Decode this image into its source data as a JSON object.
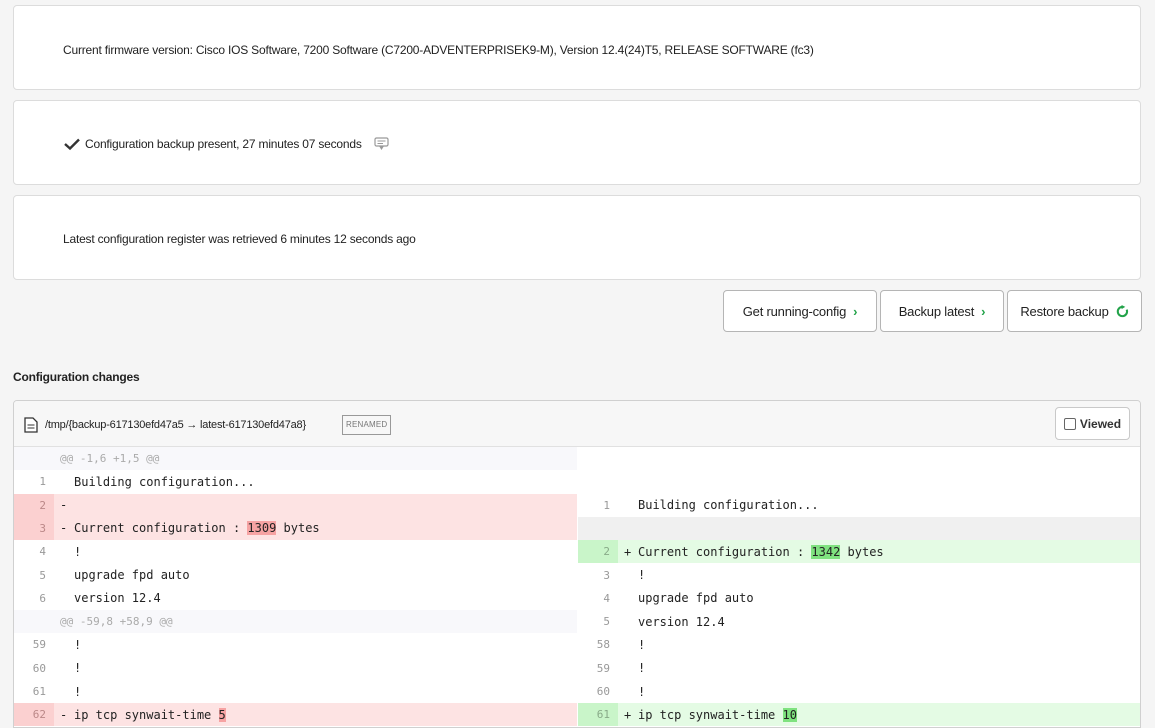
{
  "cards": {
    "firmware": "Current firmware version: Cisco IOS Software, 7200 Software (C7200-ADVENTERPRISEK9-M), Version 12.4(24)T5, RELEASE SOFTWARE (fc3)",
    "backup_status": "Configuration backup present, 27 minutes 07 seconds",
    "register": "Latest configuration register was retrieved 6 minutes 12 seconds ago"
  },
  "actions": {
    "get_running": "Get running-config",
    "backup_latest": "Backup latest",
    "restore_backup": "Restore backup"
  },
  "changes_title": "Configuration changes",
  "diff": {
    "file_path": "/tmp/{backup-617130efd47a5 → latest-617130efd47a8}",
    "badge": "RENAMED",
    "viewed_label": "Viewed",
    "left": [
      {
        "type": "hunk",
        "ln": "",
        "code": "@@ -1,6 +1,5 @@"
      },
      {
        "type": "ctx",
        "ln": "1",
        "code": "Building configuration..."
      },
      {
        "type": "del",
        "ln": "2",
        "code": ""
      },
      {
        "type": "del",
        "ln": "3",
        "pre": "Current configuration : ",
        "hl": "1309",
        "post": " bytes"
      },
      {
        "type": "ctx",
        "ln": "4",
        "code": "!"
      },
      {
        "type": "ctx",
        "ln": "5",
        "code": "upgrade fpd auto"
      },
      {
        "type": "ctx",
        "ln": "6",
        "code": "version 12.4"
      },
      {
        "type": "hunk",
        "ln": "",
        "code": "@@ -59,8 +58,9 @@"
      },
      {
        "type": "ctx",
        "ln": "59",
        "code": "!"
      },
      {
        "type": "ctx",
        "ln": "60",
        "code": "!"
      },
      {
        "type": "ctx",
        "ln": "61",
        "code": "!"
      },
      {
        "type": "del",
        "ln": "62",
        "pre": "ip tcp synwait-time ",
        "hl": "5",
        "post": ""
      }
    ],
    "right": [
      {
        "type": "blank"
      },
      {
        "type": "blank"
      },
      {
        "type": "ctx",
        "ln": "1",
        "code": "Building configuration..."
      },
      {
        "type": "empty"
      },
      {
        "type": "add",
        "ln": "2",
        "pre": "Current configuration : ",
        "hl": "1342",
        "post": " bytes"
      },
      {
        "type": "ctx",
        "ln": "3",
        "code": "!"
      },
      {
        "type": "ctx",
        "ln": "4",
        "code": "upgrade fpd auto"
      },
      {
        "type": "ctx",
        "ln": "5",
        "code": "version 12.4"
      },
      {
        "type": "ctx",
        "ln": "58",
        "code": "!"
      },
      {
        "type": "ctx",
        "ln": "59",
        "code": "!"
      },
      {
        "type": "ctx",
        "ln": "60",
        "code": "!"
      },
      {
        "type": "add",
        "ln": "61",
        "pre": "ip tcp synwait-time ",
        "hl": "10",
        "post": ""
      }
    ]
  }
}
